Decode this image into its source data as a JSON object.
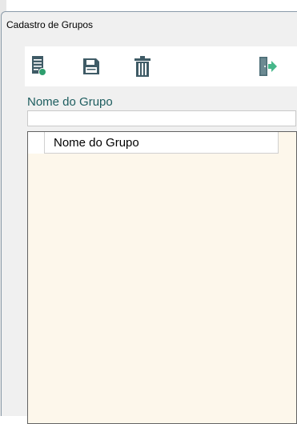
{
  "window": {
    "title": "Cadastro de Grupos"
  },
  "toolbar": {
    "buttons": [
      {
        "name": "new-document",
        "icon": "new-document-icon"
      },
      {
        "name": "save",
        "icon": "floppy-disk-icon"
      },
      {
        "name": "delete",
        "icon": "trash-icon"
      },
      {
        "name": "exit",
        "icon": "exit-door-icon"
      }
    ]
  },
  "form": {
    "group_name_label": "Nome do Grupo",
    "group_name_value": "",
    "group_name_placeholder": ""
  },
  "grid": {
    "columns": [
      "Nome do Grupo"
    ],
    "rows": []
  },
  "colors": {
    "window_bg": "#f0f0f0",
    "window_border": "#8a9aa9",
    "label_color": "#1d5d5f",
    "grid_bg": "#fdf7eb",
    "grid_border": "#636363",
    "icon_dark": "#3f5b66",
    "icon_green": "#2e9e6e",
    "exit_door": "#4a6b74",
    "exit_arrow": "#46b78a"
  }
}
